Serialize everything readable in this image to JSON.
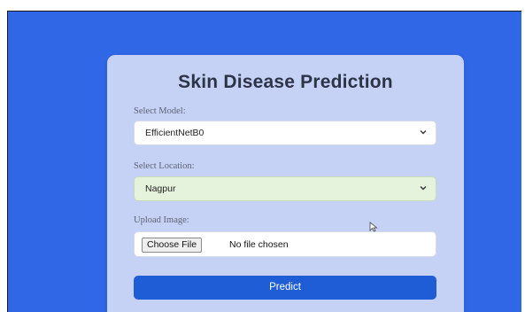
{
  "form": {
    "title": "Skin Disease Prediction",
    "model_label": "Select Model:",
    "model_value": "EfficientNetB0",
    "location_label": "Select Location:",
    "location_value": "Nagpur",
    "upload_label": "Upload Image:",
    "choose_file_label": "Choose File",
    "file_status": "No file chosen",
    "predict_label": "Predict"
  },
  "icons": {
    "dropdown": "chevron-down-icon",
    "pointer": "mouse-cursor-icon"
  },
  "colors": {
    "background": "#2f67e6",
    "card": "#c5d2f5",
    "primary_button": "#1f5dd6",
    "location_select": "#e6f3dc"
  }
}
